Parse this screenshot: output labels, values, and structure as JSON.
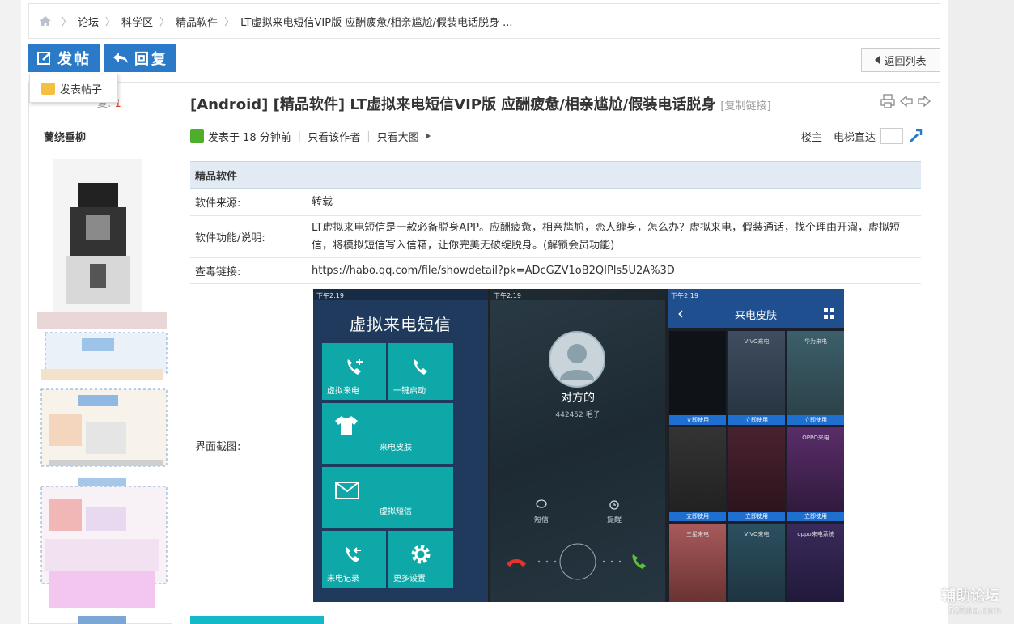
{
  "breadcrumb": {
    "items": [
      "论坛",
      "科学区",
      "精品软件",
      "LT虚拟来电短信VIP版 应酬疲惫/相亲尴尬/假装电话脱身 ..."
    ]
  },
  "toolbar": {
    "post_label": "发帖",
    "reply_label": "回复",
    "back_label": "返回列表"
  },
  "popup": {
    "new_thread_label": "发表帖子"
  },
  "left": {
    "reply_label": "复:",
    "reply_count": "1",
    "author_name": "蘭绕垂柳"
  },
  "post": {
    "title": "[Android] [精品软件] LT虚拟来电短信VIP版 应酬疲惫/相亲尴尬/假装电话脱身",
    "copy_link": "[复制链接]",
    "posted": "发表于 18 分钟前",
    "only_author": "只看该作者",
    "only_big_image": "只看大图",
    "floor": "楼主",
    "elevator": "电梯直达"
  },
  "info": {
    "header": "精品软件",
    "rows": [
      {
        "key": "软件来源:",
        "value": "转载"
      },
      {
        "key": "软件功能/说明:",
        "value": "LT虚拟来电短信是一款必备脱身APP。应酬疲惫，相亲尴尬，恋人缠身，怎么办？虚拟来电，假装通话，找个理由开溜，虚拟短信，将模拟短信写入信箱，让你完美无破绽脱身。(解锁会员功能)"
      },
      {
        "key": "查毒链接:",
        "value": "https://habo.qq.com/file/showdetail?pk=ADcGZV1oB2QIPls5U2A%3D"
      },
      {
        "key": "界面截图:",
        "value": ""
      }
    ]
  },
  "screens": {
    "status_time": "下午2:19",
    "app_title": "虚拟来电短信",
    "tiles": [
      "虚拟来电",
      "一键启动",
      "来电皮肤",
      "虚拟短信",
      "来电记录",
      "更多设置"
    ],
    "caller_name": "对方的",
    "caller_number": "442452 毛子",
    "sms_label": "短信",
    "remind_label": "提醒",
    "skin_title": "来电皮肤",
    "skin_use": "立即使用",
    "skin_names": [
      "",
      "VIVO来电",
      "华为来电",
      "",
      "",
      "OPPO来电",
      "三星来电",
      "VIVO来电",
      "oppo来电系统"
    ]
  },
  "watermark": {
    "line1": "辅助论坛",
    "line2": "52fzba.com"
  }
}
